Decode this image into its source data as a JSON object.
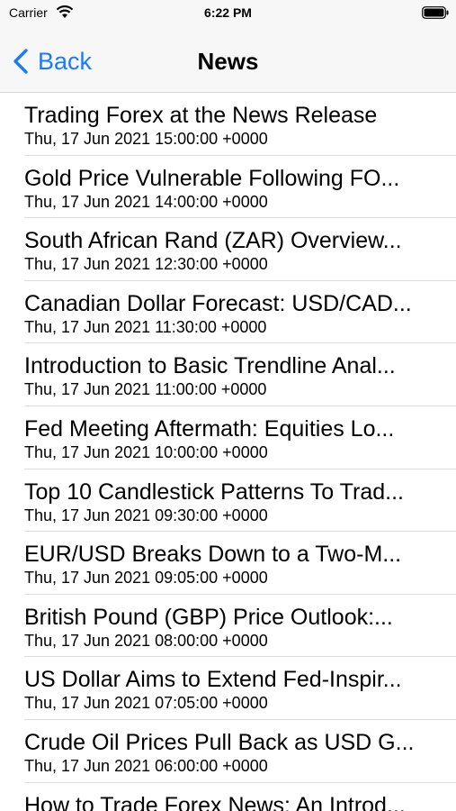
{
  "status_bar": {
    "carrier": "Carrier",
    "time": "6:22 PM",
    "icons": [
      "wifi-icon",
      "battery-icon"
    ]
  },
  "nav": {
    "back_label": "Back",
    "title": "News",
    "accent_color": "#1a7cf5"
  },
  "news": [
    {
      "title": "Trading Forex at the News Release",
      "date": "Thu, 17 Jun 2021 15:00:00 +0000"
    },
    {
      "title": "Gold Price Vulnerable Following FO...",
      "date": "Thu, 17 Jun 2021 14:00:00 +0000"
    },
    {
      "title": "South African Rand (ZAR) Overview...",
      "date": "Thu, 17 Jun 2021 12:30:00 +0000"
    },
    {
      "title": "Canadian Dollar Forecast: USD/CAD...",
      "date": "Thu, 17 Jun 2021 11:30:00 +0000"
    },
    {
      "title": "Introduction to Basic Trendline Anal...",
      "date": "Thu, 17 Jun 2021 11:00:00 +0000"
    },
    {
      "title": "Fed Meeting Aftermath: Equities Lo...",
      "date": "Thu, 17 Jun 2021 10:00:00 +0000"
    },
    {
      "title": "Top 10 Candlestick Patterns To Trad...",
      "date": "Thu, 17 Jun 2021 09:30:00 +0000"
    },
    {
      "title": "EUR/USD Breaks Down to a Two-M...",
      "date": "Thu, 17 Jun 2021 09:05:00 +0000"
    },
    {
      "title": "British Pound (GBP) Price Outlook:...",
      "date": "Thu, 17 Jun 2021 08:00:00 +0000"
    },
    {
      "title": "US Dollar Aims to Extend Fed-Inspir...",
      "date": "Thu, 17 Jun 2021 07:05:00 +0000"
    },
    {
      "title": "Crude Oil Prices Pull Back as USD G...",
      "date": "Thu, 17 Jun 2021 06:00:00 +0000"
    },
    {
      "title": "How to Trade Forex News: An Introd...",
      "date": ""
    }
  ]
}
